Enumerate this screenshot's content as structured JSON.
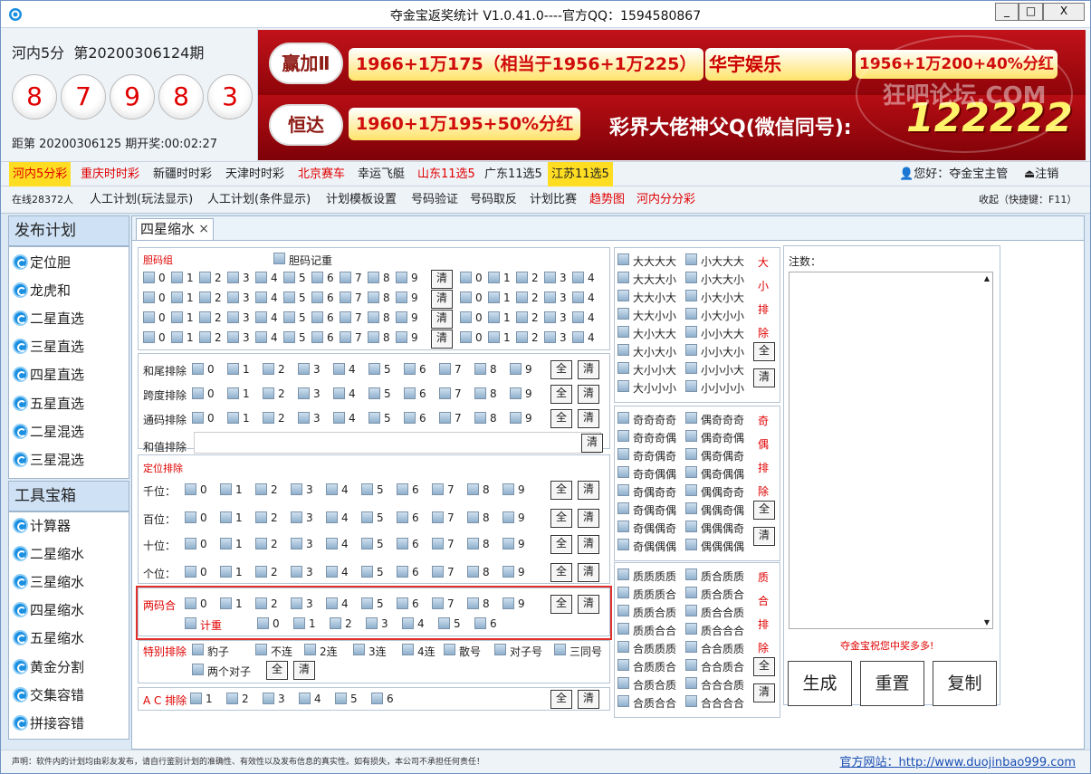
{
  "window": {
    "title": "夺金宝返奖统计  V1.0.41.0----官方QQ：1594580867",
    "min": "_",
    "max": "□",
    "close": "X"
  },
  "lottery": {
    "name": "河内5分",
    "period": "第20200306124期",
    "balls": [
      "8",
      "7",
      "9",
      "8",
      "3"
    ],
    "countdown": "距第 20200306125 期开奖:00:02:27"
  },
  "banner": {
    "logo1": "赢加Ⅱ",
    "promo1": "1966+1万175（相当于1956+1万225）",
    "brand2": "华宇娱乐",
    "promo2": "1956+1万200+40%分红",
    "logo3": "恒达",
    "promo3": "1960+1万195+50%分红",
    "slogan": "彩界大佬神父Q(微信同号):",
    "number": "122222",
    "watermark": "狂吧论坛.COM"
  },
  "nav1": [
    "河内5分彩",
    "重庆时时彩",
    "新疆时时彩",
    "天津时时彩",
    "北京赛车",
    "幸运飞艇",
    "山东11选5",
    "广东11选5",
    "江苏11选5"
  ],
  "user": {
    "greeting": "您好：夺金宝主管",
    "logout": "注销"
  },
  "nav2": {
    "online": "在线28372人",
    "items": [
      "人工计划(玩法显示)",
      "人工计划(条件显示)",
      "计划模板设置",
      "号码验证",
      "号码取反",
      "计划比赛",
      "趋势图",
      "河内分分彩"
    ],
    "shortcut": "收起（快捷键：F11）"
  },
  "sidebar": {
    "publish_title": "发布计划",
    "publish": [
      "定位胆",
      "龙虎和",
      "二星直选",
      "三星直选",
      "四星直选",
      "五星直选",
      "二星混选",
      "三星混选"
    ],
    "tools_title": "工具宝箱",
    "tools": [
      "计算器",
      "二星缩水",
      "三星缩水",
      "四星缩水",
      "五星缩水",
      "黄金分割",
      "交集容错",
      "拼接容错"
    ]
  },
  "main": {
    "tab": "四星缩水",
    "tab_close": "×"
  },
  "form": {
    "dan_title": "胆码组",
    "dan_repeat": "胆码记重",
    "digits": [
      "0",
      "1",
      "2",
      "3",
      "4",
      "5",
      "6",
      "7",
      "8",
      "9"
    ],
    "dan_right": [
      "0",
      "1",
      "2",
      "3",
      "4"
    ],
    "btn_all": "全",
    "btn_clear": "清",
    "hewei": "和尾排除",
    "kuadu": "跨度排除",
    "tongma": "通码排除",
    "hezhi": "和值排除",
    "dingwei_title": "定位排除",
    "positions": [
      "千位：",
      "百位：",
      "十位：",
      "个位："
    ],
    "liangma": "两码合",
    "jizhong": "计重",
    "liangma_row2": [
      "0",
      "1",
      "2",
      "3",
      "4",
      "5",
      "6"
    ],
    "teshu": "特别排除",
    "teshu_items": [
      "豹子",
      "不连",
      "2连",
      "3连",
      "4连",
      "散号",
      "对子号",
      "三同号"
    ],
    "two_pairs": "两个对子",
    "ac": "A C 排除",
    "ac_items": [
      "1",
      "2",
      "3",
      "4",
      "5",
      "6"
    ],
    "dx": [
      "大大大大",
      "大大大小",
      "大大小大",
      "大大小小",
      "大小大大",
      "大小大小",
      "大小小大",
      "大小小小"
    ],
    "dx2": [
      "小大大大",
      "小大大小",
      "小大小大",
      "小大小小",
      "小小大大",
      "小小大小",
      "小小小大",
      "小小小小"
    ],
    "dx_label": [
      "大",
      "小",
      "排",
      "除"
    ],
    "jo": [
      "奇奇奇奇",
      "奇奇奇偶",
      "奇奇偶奇",
      "奇奇偶偶",
      "奇偶奇奇",
      "奇偶奇偶",
      "奇偶偶奇",
      "奇偶偶偶"
    ],
    "jo2": [
      "偶奇奇奇",
      "偶奇奇偶",
      "偶奇偶奇",
      "偶奇偶偶",
      "偶偶奇奇",
      "偶偶奇偶",
      "偶偶偶奇",
      "偶偶偶偶"
    ],
    "jo_label": [
      "奇",
      "偶",
      "排",
      "除"
    ],
    "zh": [
      "质质质质",
      "质质质合",
      "质质合质",
      "质质合合",
      "合质质质",
      "合质质合",
      "合质合质",
      "合质合合"
    ],
    "zh2": [
      "质合质质",
      "质合质合",
      "质合合质",
      "质合合合",
      "合合质质",
      "合合质合",
      "合合合质",
      "合合合合"
    ],
    "zh_label": [
      "质",
      "合",
      "排",
      "除"
    ]
  },
  "notes": {
    "label": "注数：",
    "wish": "夺金宝祝您中奖多多!",
    "generate": "生成",
    "reset": "重置",
    "copy": "复制"
  },
  "status": {
    "disclaimer": "声明：软件内的计划均由彩友发布，请自行鉴别计划的准确性、有效性以及发布信息的真实性。如有损失，本公司不承担任何责任！",
    "site": "官方网站：http://www.duojinbao999.com"
  },
  "colors": {
    "accent_red": "#e00000",
    "highlight": "#ffdd22",
    "banner": "#b3060c"
  }
}
